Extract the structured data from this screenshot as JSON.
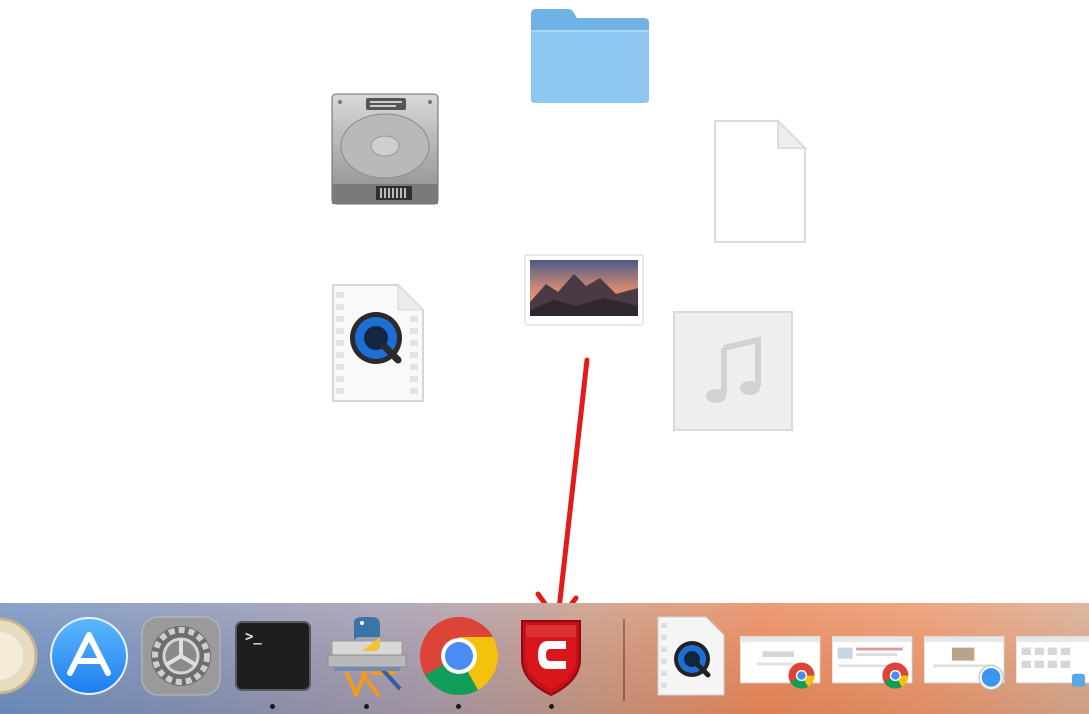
{
  "desktop": {
    "icons": [
      {
        "name": "folder-icon"
      },
      {
        "name": "hard-drive-icon"
      },
      {
        "name": "blank-document-icon"
      },
      {
        "name": "quicktime-movie-icon"
      },
      {
        "name": "desktop-picture-icon"
      },
      {
        "name": "music-file-icon"
      }
    ],
    "annotation_arrow_color": "#e41b17"
  },
  "terminal": {
    "prompt": ">_"
  },
  "dock": {
    "items": [
      {
        "name": "partial-app-icon",
        "running": false
      },
      {
        "name": "app-store-icon",
        "running": false
      },
      {
        "name": "system-preferences-icon",
        "running": false
      },
      {
        "name": "terminal-icon",
        "running": true
      },
      {
        "name": "python-launcher-icon",
        "running": true
      },
      {
        "name": "chrome-icon",
        "running": true
      },
      {
        "name": "comodo-antivirus-icon",
        "running": true
      },
      {
        "name": "quicktime-document-thumbnail",
        "running": false
      },
      {
        "name": "chrome-window-thumbnail-1",
        "running": false
      },
      {
        "name": "chrome-window-thumbnail-2",
        "running": false
      },
      {
        "name": "safari-window-thumbnail",
        "running": false
      },
      {
        "name": "window-thumbnail-partial",
        "running": false
      }
    ],
    "accent_colors": {
      "comodo_red": "#d8161b",
      "chrome_blue": "#4c8bf5"
    }
  }
}
